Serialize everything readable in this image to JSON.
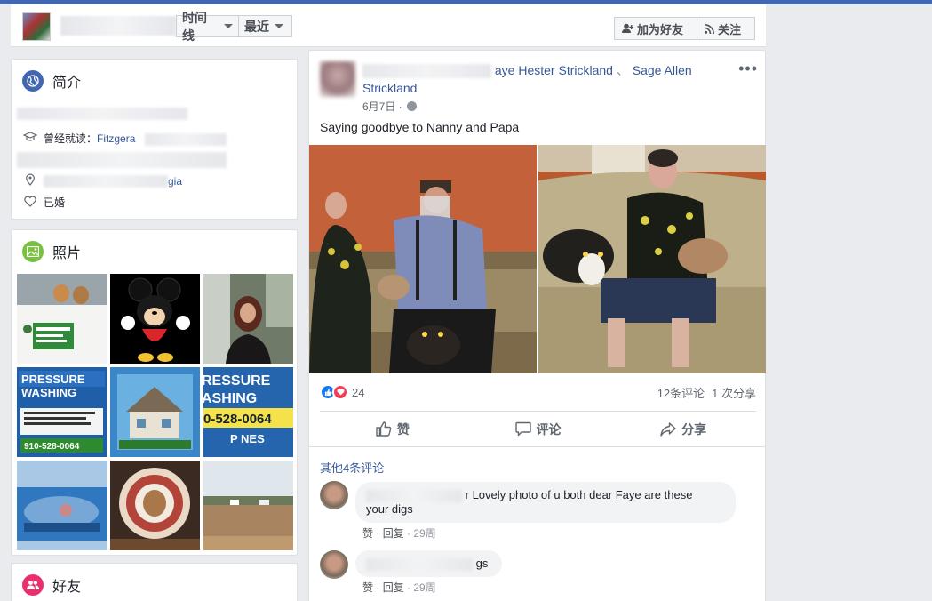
{
  "header": {
    "nav_timeline": "时间线",
    "nav_recent": "最近",
    "add_friend": "加为好友",
    "follow": "关注"
  },
  "intro": {
    "title": "简介",
    "education_label": "曾经就读：",
    "education_value": "Fitzgera",
    "location_value": "gia",
    "relationship": "已婚"
  },
  "photos": {
    "title": "照片",
    "items": [
      {
        "name": "van-dogs-photo"
      },
      {
        "name": "mickey-photo"
      },
      {
        "name": "woman-portrait-photo"
      },
      {
        "name": "pressure-washing-sign-photo"
      },
      {
        "name": "house-flyer-photo"
      },
      {
        "name": "pressure-washing-phone-photo"
      },
      {
        "name": "banner-photo"
      },
      {
        "name": "lion-logo-photo"
      },
      {
        "name": "field-photo"
      }
    ]
  },
  "friends": {
    "title": "好友"
  },
  "post": {
    "author_line_1": "aye Hester Strickland",
    "separator": "、",
    "author_line_2": "Sage Allen",
    "author_line_3": "Strickland",
    "date": "6月7日 ·",
    "text": "Saying goodbye to Nanny and Papa",
    "reaction_count": "24",
    "comment_count": "12条评论",
    "share_count": "1 次分享",
    "actions": {
      "like": "赞",
      "comment": "评论",
      "share": "分享"
    },
    "more_comments": "其他4条评论",
    "comments": [
      {
        "text_line_1": "r Lovely photo of u both dear Faye are these",
        "text_line_2": "your digs",
        "like": "赞",
        "reply": "回复",
        "time": "29周"
      },
      {
        "text": "gs",
        "like": "赞",
        "reply": "回复",
        "time": "29周"
      }
    ]
  },
  "colors": {
    "brand": "#4267b2",
    "link": "#365899",
    "like": "#1877f2",
    "love": "#f33e58"
  }
}
